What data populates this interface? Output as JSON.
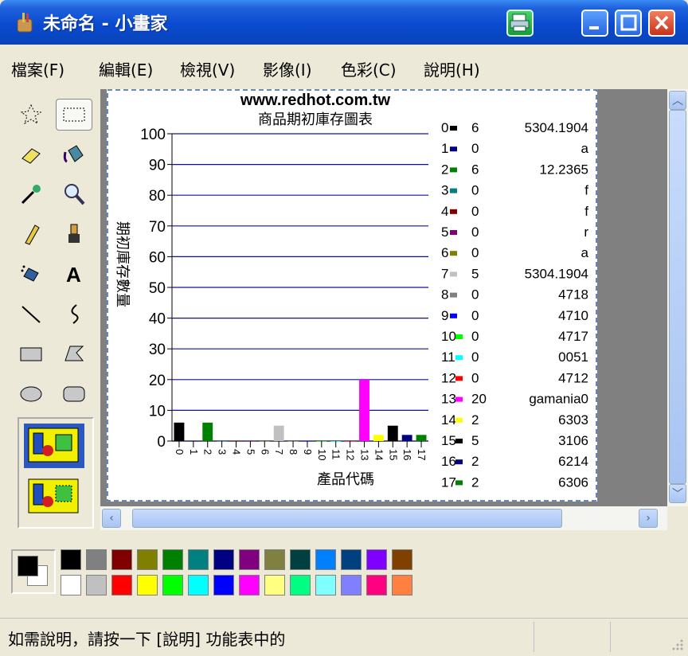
{
  "window": {
    "title": "未命名 - 小畫家"
  },
  "menu": [
    "檔案(F)",
    "編輯(E)",
    "檢視(V)",
    "影像(I)",
    "色彩(C)",
    "說明(H)"
  ],
  "status": {
    "text": "如需說明，請按一下 [說明] 功能表中的"
  },
  "palette": {
    "foreground": "#000000",
    "background": "#ffffff",
    "top": [
      "#000000",
      "#808080",
      "#800000",
      "#808000",
      "#008000",
      "#008080",
      "#000080",
      "#800080",
      "#808040",
      "#004040",
      "#0080ff",
      "#004080",
      "#8000ff",
      "#804000"
    ],
    "bottom": [
      "#ffffff",
      "#c0c0c0",
      "#ff0000",
      "#ffff00",
      "#00ff00",
      "#00ffff",
      "#0000ff",
      "#ff00ff",
      "#ffff80",
      "#00ff80",
      "#80ffff",
      "#8080ff",
      "#ff0080",
      "#ff8040"
    ]
  },
  "chart_data": {
    "type": "bar",
    "title": "www.redhot.com.tw",
    "subtitle": "商品期初庫存圖表",
    "ylabel": "期初庫存數量",
    "xlabel": "產品代碼",
    "ylim": [
      0,
      100
    ],
    "yticks": [
      "100",
      "90",
      "80",
      "70",
      "60",
      "50",
      "40",
      "30",
      "20",
      "10",
      "0"
    ],
    "grid": true,
    "categories": [
      "0",
      "1",
      "2",
      "3",
      "4",
      "5",
      "6",
      "7",
      "8",
      "9",
      "10",
      "11",
      "12",
      "13",
      "14",
      "15",
      "16",
      "17"
    ],
    "values": [
      6,
      0,
      6,
      0,
      0,
      0,
      0,
      5,
      0,
      0,
      0,
      0,
      0,
      20,
      2,
      5,
      2,
      2
    ],
    "colors": [
      "#000000",
      "#000080",
      "#008000",
      "#008080",
      "#800000",
      "#800080",
      "#808000",
      "#c0c0c0",
      "#808080",
      "#0000ff",
      "#00ff00",
      "#00ffff",
      "#ff0000",
      "#ff00ff",
      "#ffff00",
      "#000000",
      "#000080",
      "#008000"
    ],
    "legend": [
      {
        "index": "0",
        "value": "6",
        "code": "5304.1904"
      },
      {
        "index": "1",
        "value": "0",
        "code": "a"
      },
      {
        "index": "2",
        "value": "6",
        "code": "12.2365"
      },
      {
        "index": "3",
        "value": "0",
        "code": "f"
      },
      {
        "index": "4",
        "value": "0",
        "code": "f"
      },
      {
        "index": "5",
        "value": "0",
        "code": "r"
      },
      {
        "index": "6",
        "value": "0",
        "code": "a"
      },
      {
        "index": "7",
        "value": "5",
        "code": "5304.1904"
      },
      {
        "index": "8",
        "value": "0",
        "code": "4718"
      },
      {
        "index": "9",
        "value": "0",
        "code": "4710"
      },
      {
        "index": "10",
        "value": "0",
        "code": "4717"
      },
      {
        "index": "11",
        "value": "0",
        "code": "0051"
      },
      {
        "index": "12",
        "value": "0",
        "code": "4712"
      },
      {
        "index": "13",
        "value": "20",
        "code": "gamania0"
      },
      {
        "index": "14",
        "value": "2",
        "code": "6303"
      },
      {
        "index": "15",
        "value": "5",
        "code": "3106"
      },
      {
        "index": "16",
        "value": "2",
        "code": "6214"
      },
      {
        "index": "17",
        "value": "2",
        "code": "6306"
      }
    ]
  }
}
